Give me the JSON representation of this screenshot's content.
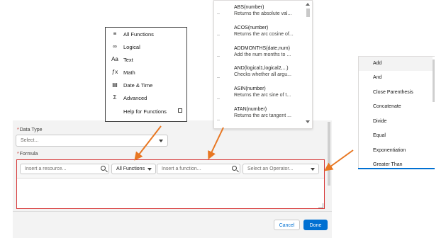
{
  "modal": {
    "data_type_label": "Data Type",
    "data_type_placeholder": "Select...",
    "formula_label": "Formula",
    "resource_placeholder": "Insert a resource...",
    "functions_filter": "All Functions",
    "function_placeholder": "Insert a function...",
    "operator_placeholder": "Select an Operator...",
    "cancel": "Cancel",
    "done": "Done"
  },
  "category_menu": {
    "items": [
      {
        "label": "All Functions",
        "icon": "list-icon",
        "glyph": "≡"
      },
      {
        "label": "Logical",
        "icon": "logical-icon",
        "glyph": "∞"
      },
      {
        "label": "Text",
        "icon": "text-icon",
        "glyph": "Aa"
      },
      {
        "label": "Math",
        "icon": "math-icon",
        "glyph": "ƒx"
      },
      {
        "label": "Date & Time",
        "icon": "calendar-icon",
        "glyph": "▤"
      },
      {
        "label": "Advanced",
        "icon": "sigma-icon",
        "glyph": "Σ"
      }
    ],
    "help": "Help for Functions"
  },
  "function_list": [
    {
      "name": "ABS(number)",
      "desc": "Returns the absolute val..."
    },
    {
      "name": "ACOS(number)",
      "desc": "Returns the arc cosine of..."
    },
    {
      "name": "ADDMONTHS(date,num)",
      "desc": "Add the num months to ..."
    },
    {
      "name": "AND(logical1,logical2,...)",
      "desc": "Checks whether all argu..."
    },
    {
      "name": "ASIN(number)",
      "desc": "Returns the arc sine of t..."
    },
    {
      "name": "ATAN(number)",
      "desc": "Returns the arc tangent ..."
    }
  ],
  "operator_list": [
    "Add",
    "And",
    "Close Parenthesis",
    "Concatenate",
    "Divide",
    "Equal",
    "Exponentiation",
    "Greater Than"
  ],
  "colors": {
    "accent": "#0070d2",
    "arrow": "#e87722",
    "error": "#d73a3a"
  }
}
